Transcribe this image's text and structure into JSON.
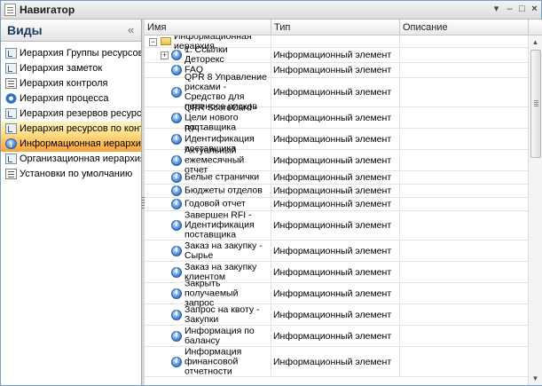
{
  "window": {
    "title": "Навигатор"
  },
  "left": {
    "title": "Виды",
    "collapse_glyph": "«",
    "items": [
      {
        "label": "Иерархия Группы ресурсов",
        "icon": "tree-icon",
        "state": ""
      },
      {
        "label": "Иерархия заметок",
        "icon": "tree-icon",
        "state": ""
      },
      {
        "label": "Иерархия контроля",
        "icon": "list-icon",
        "state": ""
      },
      {
        "label": "Иерархия процесса",
        "icon": "gear-icon",
        "state": ""
      },
      {
        "label": "Иерархия резервов ресурса",
        "icon": "tree-icon",
        "state": ""
      },
      {
        "label": "Иерархия ресурсов по контрол...",
        "icon": "tree-icon",
        "state": "hover"
      },
      {
        "label": "Информационная иерархия",
        "icon": "info-icon",
        "state": "selected"
      },
      {
        "label": "Организационная иерархия",
        "icon": "tree-icon",
        "state": ""
      },
      {
        "label": "Установки по умолчанию",
        "icon": "list-icon",
        "state": ""
      }
    ]
  },
  "grid": {
    "columns": {
      "name": "Имя",
      "type": "Тип",
      "desc": "Описание"
    },
    "root": {
      "name": "Информационная иерархия",
      "expander": "−"
    },
    "rows": [
      {
        "name": "1. Ссылки Деторекс",
        "type": "Информационный элемент",
        "expander": "+"
      },
      {
        "name": "FAQ",
        "type": "Информационный элемент"
      },
      {
        "name": "QPR 8 Управление рисками - Средство для переноса рисков",
        "type": "Информационный элемент"
      },
      {
        "name": "QPR ScoreCard - Цели нового поставщика",
        "type": "Информационный элемент"
      },
      {
        "name": "RFI - Идентификация поставщика",
        "type": "Информационный элемент"
      },
      {
        "name": "Актуальный ежемесячный отчет",
        "type": "Информационный элемент"
      },
      {
        "name": "Белые странички",
        "type": "Информационный элемент"
      },
      {
        "name": "Бюджеты отделов",
        "type": "Информационный элемент"
      },
      {
        "name": "Годовой отчет",
        "type": "Информационный элемент"
      },
      {
        "name": "Завершен RFI - Идентификация поставщика",
        "type": "Информационный элемент"
      },
      {
        "name": "Заказ на закупку - Сырье",
        "type": "Информационный элемент"
      },
      {
        "name": "Заказ на закупку клиентом",
        "type": "Информационный элемент"
      },
      {
        "name": "Закрыть получаемый запрос",
        "type": "Информационный элемент"
      },
      {
        "name": "Запрос на квоту - Закупки",
        "type": "Информационный элемент"
      },
      {
        "name": "Информация по балансу",
        "type": "Информационный элемент"
      },
      {
        "name": "Информация финансовой отчетности",
        "type": "Информационный элемент"
      }
    ]
  }
}
